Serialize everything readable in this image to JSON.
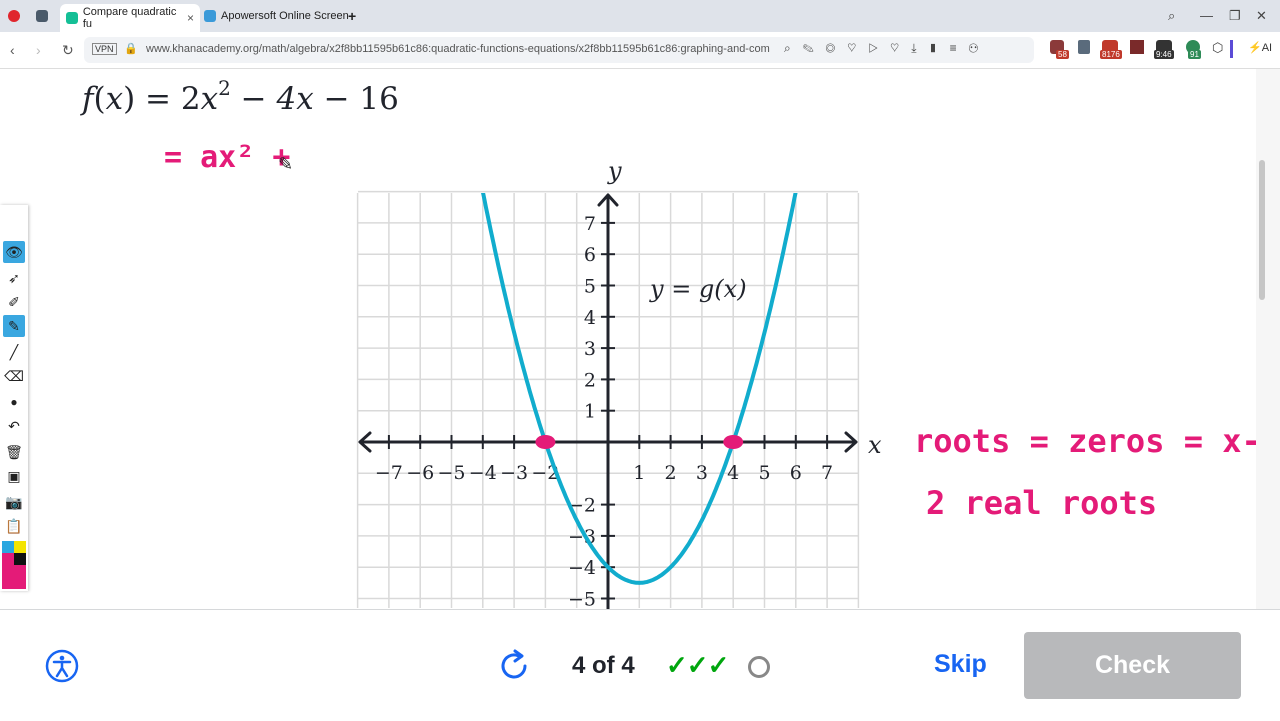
{
  "browser": {
    "tabs": [
      {
        "label": "Compare quadratic fu",
        "active": true
      },
      {
        "label": "Apowersoft Online Screen",
        "active": false
      }
    ],
    "new_tab": "+",
    "url": "www.khanacademy.org/math/algebra/x2f8bb11595b61c86:quadratic-functions-equations/x2f8bb11595b61c86:graphing-and-com",
    "vpn_label": "VPN",
    "ext_badges": [
      "58",
      "8176",
      "9:46",
      "91"
    ],
    "ai_label": "AI"
  },
  "problem": {
    "equation": {
      "fname": "f",
      "var": "x",
      "coef1": "2",
      "exp": "2",
      "term2": "4x",
      "term3": "16"
    },
    "graph_label": "y = g(x)"
  },
  "handwriting": {
    "line1": "= ax² +",
    "line2": "roots = zeros = x-int.",
    "line3": "2  real  roots"
  },
  "chart_data": {
    "type": "line",
    "xlabel": "x",
    "ylabel": "y",
    "xlim": [
      -8,
      8
    ],
    "ylim": [
      -5,
      8
    ],
    "x_ticks": [
      "−7",
      "−6",
      "−5",
      "−4",
      "−3",
      "−2",
      "1",
      "2",
      "3",
      "4",
      "5",
      "6",
      "7"
    ],
    "y_ticks": [
      "7",
      "6",
      "5",
      "4",
      "3",
      "2",
      "1",
      "−2",
      "−3",
      "−4",
      "−5"
    ],
    "series": [
      {
        "function": "y = 0.5(x - 1)^2 - 4.5",
        "vertex": [
          1,
          -4.5
        ],
        "color": "#11accd"
      }
    ],
    "x_intercepts": [
      -2,
      4
    ],
    "marker_color": "#e41b78",
    "grid": true
  },
  "footer": {
    "progress_text": "4 of 4",
    "checks": [
      "✓",
      "✓",
      "✓"
    ],
    "skip_label": "Skip",
    "check_label": "Check"
  }
}
